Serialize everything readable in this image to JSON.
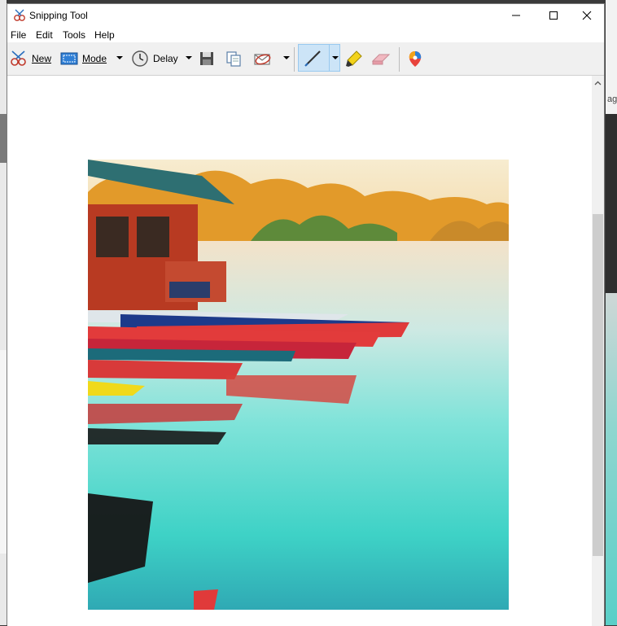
{
  "window": {
    "title": "Snipping Tool"
  },
  "menu": [
    "File",
    "Edit",
    "Tools",
    "Help"
  ],
  "toolbar": {
    "new_label": "New",
    "mode_label": "Mode",
    "delay_label": "Delay"
  },
  "background": {
    "right_fragment_text": "ag"
  },
  "colors": {
    "toolbar_bg": "#f0f0f0",
    "pen_active_bg": "#cce4f7",
    "pen_active_border": "#99c9ef",
    "window_border": "#7a7a7a"
  }
}
